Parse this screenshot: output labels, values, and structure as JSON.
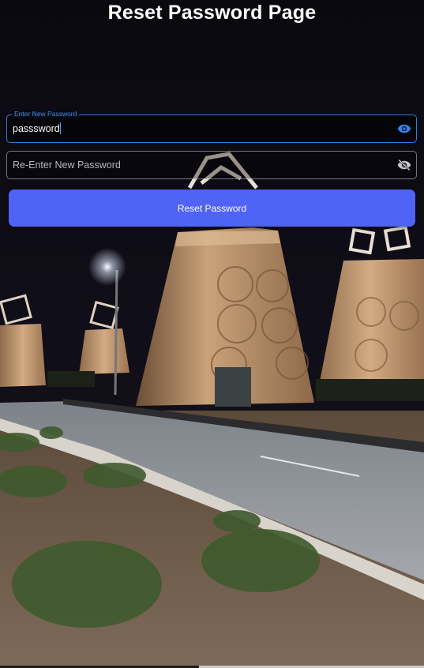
{
  "page": {
    "title": "Reset Password Page"
  },
  "form": {
    "new_password": {
      "label": "Enter New Password",
      "value": "passsword",
      "icon": "eye-icon"
    },
    "confirm_password": {
      "placeholder": "Re-Enter New Password",
      "value": "",
      "icon": "eye-off-icon"
    },
    "submit_label": "Reset Password"
  },
  "colors": {
    "accent": "#2f7fe0",
    "button": "#4f63f7",
    "text": "#ffffff"
  }
}
